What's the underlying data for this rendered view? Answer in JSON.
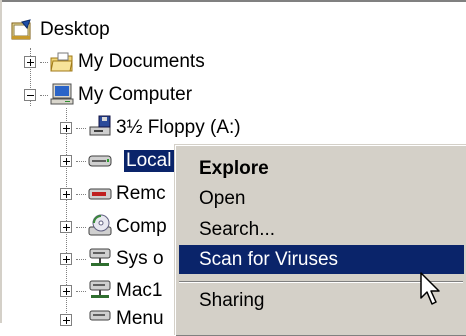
{
  "tree": {
    "root": {
      "label": "Desktop",
      "icon": "desktop-icon"
    },
    "items": [
      {
        "label": "My Documents",
        "icon": "folder-documents-icon",
        "expander": "plus"
      },
      {
        "label": "My Computer",
        "icon": "my-computer-icon",
        "expander": "minus"
      }
    ],
    "drives": [
      {
        "label": "3½ Floppy (A:)",
        "icon": "floppy-drive-icon"
      },
      {
        "label": "Local Disk (C:)",
        "visible_label": "Local",
        "icon": "hard-drive-icon",
        "selected": true
      },
      {
        "label": "Remc",
        "icon": "removable-drive-icon"
      },
      {
        "label": "Comp",
        "icon": "cd-drive-icon"
      },
      {
        "label": "Sys o",
        "icon": "network-drive-icon"
      },
      {
        "label": "Mac1",
        "icon": "network-drive-icon"
      },
      {
        "label": "Menu",
        "icon": "network-drive-icon"
      }
    ]
  },
  "context_menu": {
    "items": [
      {
        "label": "Explore",
        "bold": true
      },
      {
        "label": "Open"
      },
      {
        "label": "Search..."
      },
      {
        "label": "Scan for Viruses",
        "highlighted": true
      },
      {
        "label": "Sharing"
      }
    ]
  },
  "colors": {
    "selection": "#0a246a",
    "menu_background": "#d4d0c8",
    "tree_line": "#808080"
  }
}
